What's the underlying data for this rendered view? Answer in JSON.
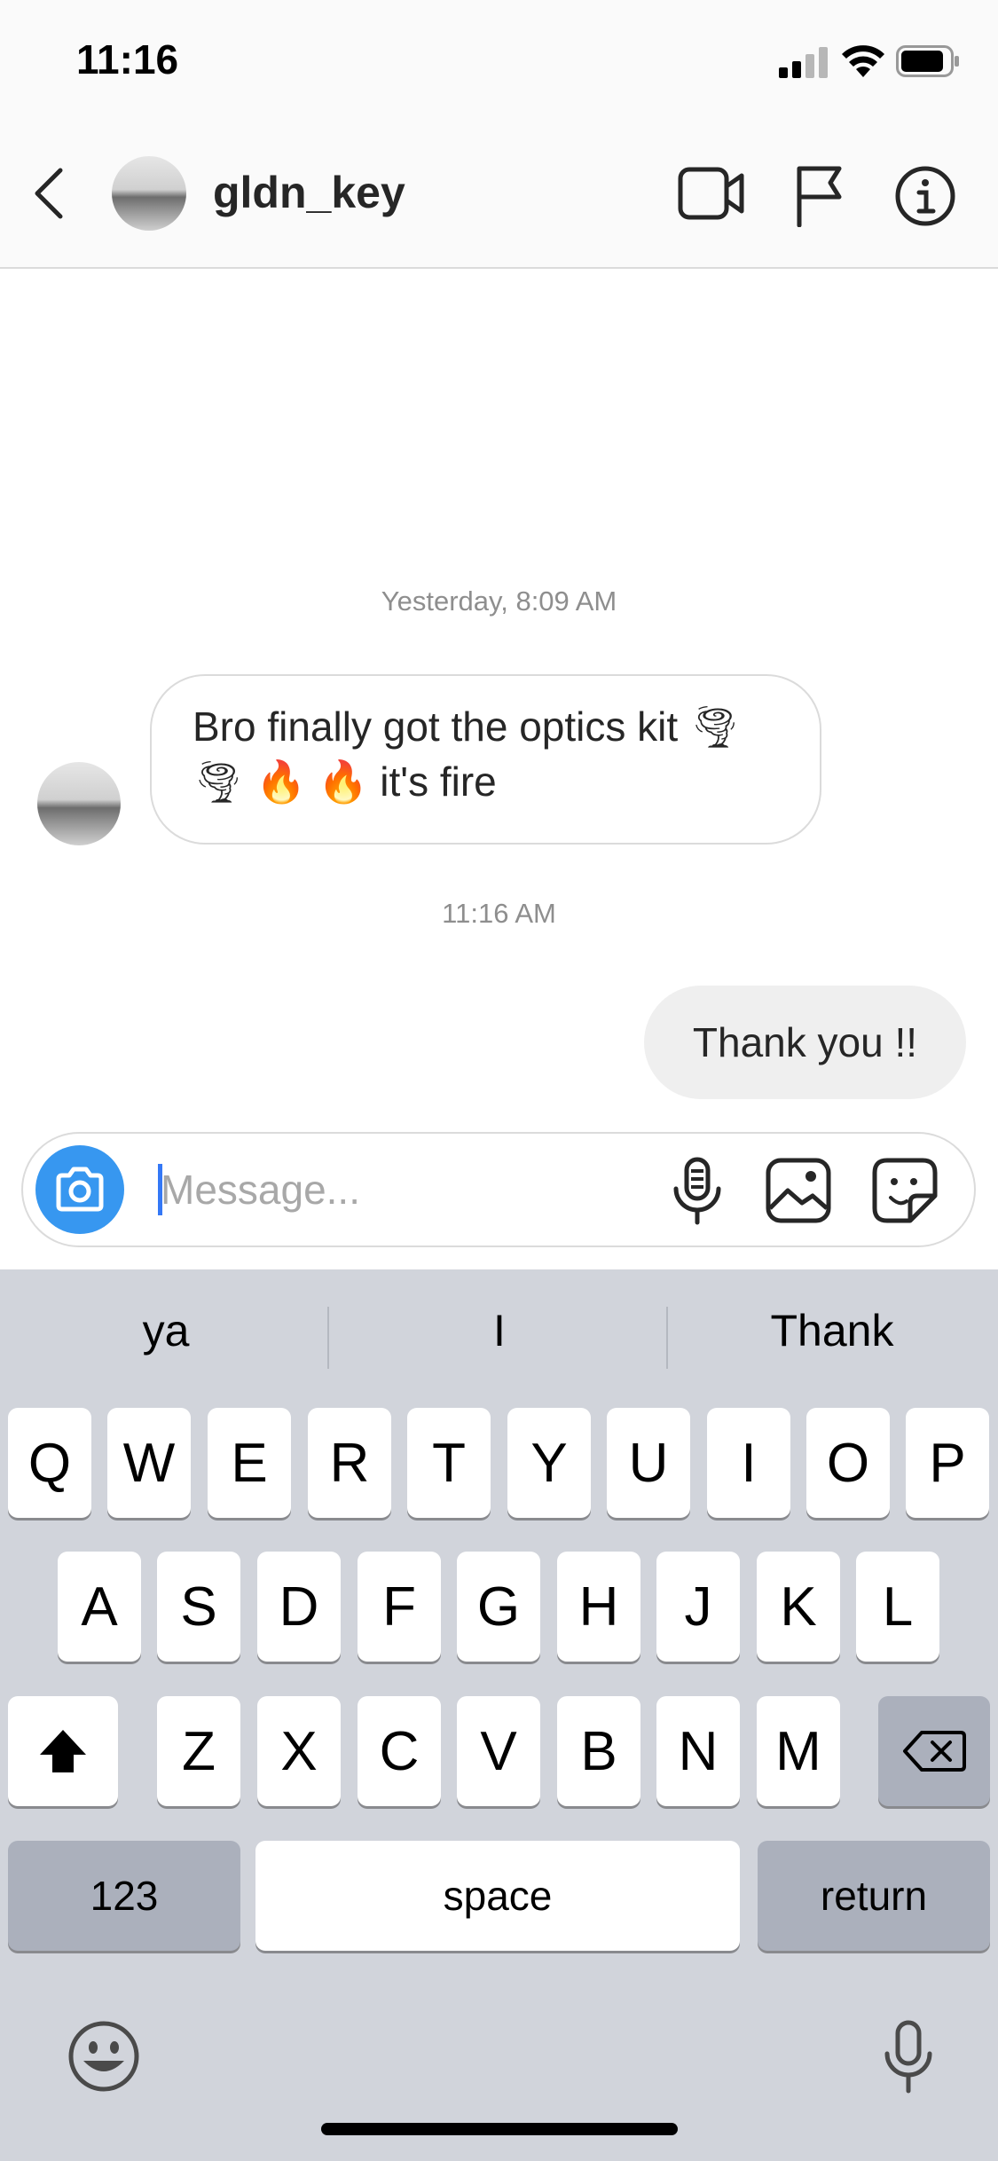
{
  "status_bar": {
    "time": "11:16"
  },
  "header": {
    "username": "gldn_key"
  },
  "messages": {
    "timestamp_1": "Yesterday, 8:09 AM",
    "incoming_line_1": "Bro finally got the optics kit 🌪",
    "incoming_line_2": "🌪 🔥 🔥 it's fire",
    "timestamp_2": "11:16 AM",
    "outgoing": "Thank you !!"
  },
  "composer": {
    "placeholder": "Message..."
  },
  "keyboard": {
    "suggestions": [
      "ya",
      "I",
      "Thank"
    ],
    "row1": [
      "Q",
      "W",
      "E",
      "R",
      "T",
      "Y",
      "U",
      "I",
      "O",
      "P"
    ],
    "row2": [
      "A",
      "S",
      "D",
      "F",
      "G",
      "H",
      "J",
      "K",
      "L"
    ],
    "row3": [
      "Z",
      "X",
      "C",
      "V",
      "B",
      "N",
      "M"
    ],
    "numbers_key": "123",
    "space_key": "space",
    "return_key": "return"
  },
  "colors": {
    "accent": "#3797f0",
    "caret": "#3478f6",
    "keyboard_bg": "#d1d4db"
  },
  "icons": [
    "signal-icon",
    "wifi-icon",
    "battery-icon",
    "back-chevron-icon",
    "video-call-icon",
    "flag-icon",
    "info-icon",
    "camera-icon",
    "microphone-icon",
    "gallery-icon",
    "sticker-icon",
    "shift-icon",
    "backspace-icon",
    "emoji-icon",
    "dictation-icon"
  ]
}
